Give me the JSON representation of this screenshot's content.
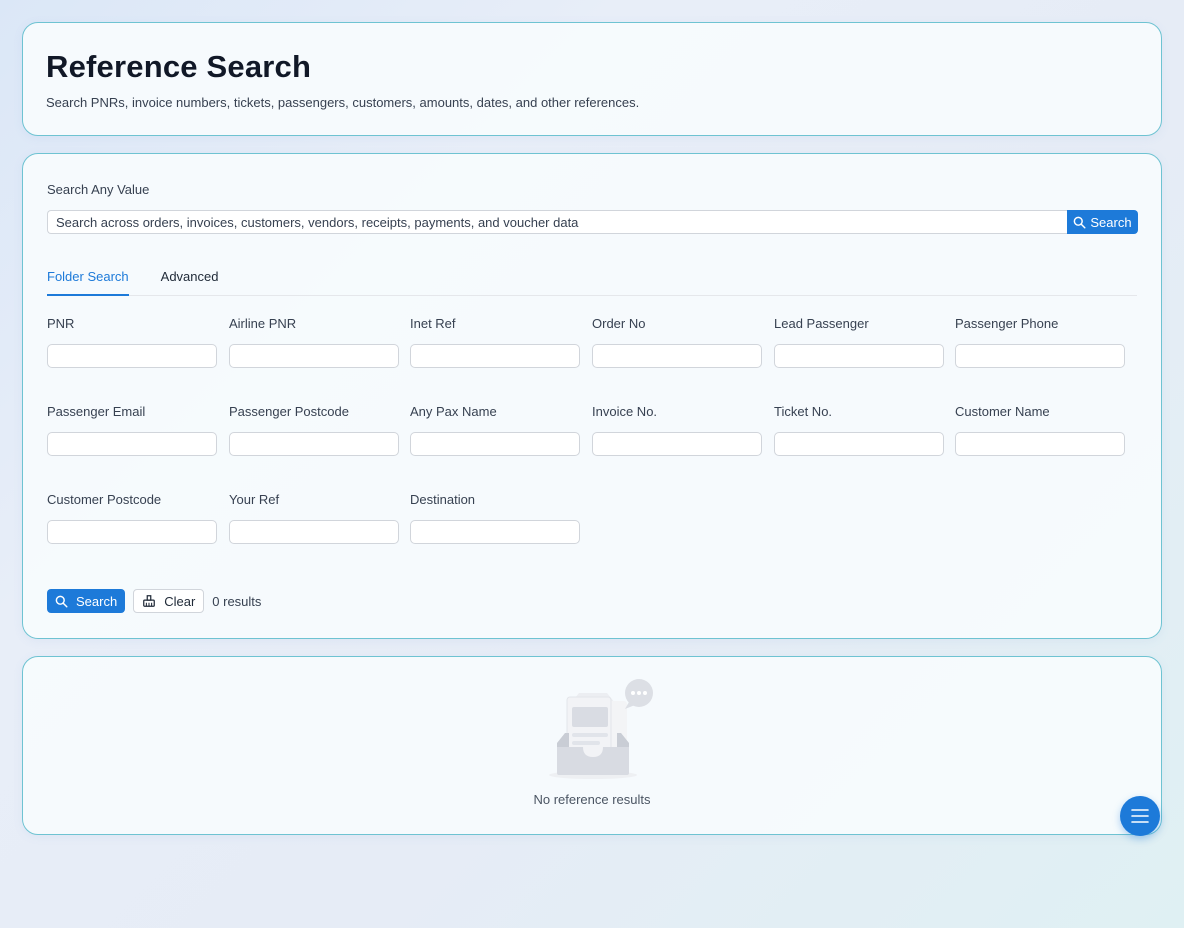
{
  "header": {
    "title": "Reference Search",
    "subtitle": "Search PNRs, invoice numbers, tickets, passengers, customers, amounts, dates, and other references."
  },
  "search_any": {
    "label": "Search Any Value",
    "placeholder": "Search across orders, invoices, customers, vendors, receipts, payments, and voucher data",
    "button_label": "Search",
    "button_icon": "search-icon"
  },
  "tabs": [
    {
      "label": "Folder Search",
      "active": true
    },
    {
      "label": "Advanced",
      "active": false
    }
  ],
  "fields": [
    {
      "label": "PNR",
      "value": ""
    },
    {
      "label": "Airline PNR",
      "value": ""
    },
    {
      "label": "Inet Ref",
      "value": ""
    },
    {
      "label": "Order No",
      "value": ""
    },
    {
      "label": "Lead Passenger",
      "value": ""
    },
    {
      "label": "Passenger Phone",
      "value": ""
    },
    {
      "label": "Passenger Email",
      "value": ""
    },
    {
      "label": "Passenger Postcode",
      "value": ""
    },
    {
      "label": "Any Pax Name",
      "value": ""
    },
    {
      "label": "Invoice No.",
      "value": ""
    },
    {
      "label": "Ticket No.",
      "value": ""
    },
    {
      "label": "Customer Name",
      "value": ""
    },
    {
      "label": "Customer Postcode",
      "value": ""
    },
    {
      "label": "Your Ref",
      "value": ""
    },
    {
      "label": "Destination",
      "value": ""
    }
  ],
  "actions": {
    "search_label": "Search",
    "search_icon": "search-icon",
    "clear_label": "Clear",
    "clear_icon": "clear-icon",
    "results_count": "0 results"
  },
  "results": {
    "empty_text": "No reference results",
    "empty_icon": "empty-inbox-icon"
  },
  "fab": {
    "icon": "menu-icon"
  },
  "colors": {
    "accent": "#1d7ad9",
    "card_border": "#6ec3d2",
    "text": "#1f2937"
  }
}
